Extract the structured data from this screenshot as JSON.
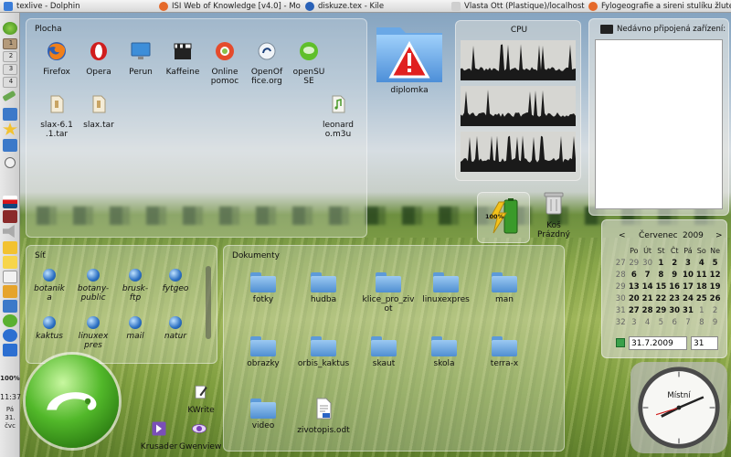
{
  "taskbar": {
    "tasks": [
      {
        "label": "texlive - Dolphin",
        "color": "#3b7dd8"
      },
      {
        "label": "ISI Web of Knowledge [v4.0] - Mo",
        "color": "#e5692a"
      },
      {
        "label": "diskuze.tex - Kile",
        "color": "#2a62b8"
      },
      {
        "label": "Vlasta Ott (Plastique)/localhost (P",
        "color": "#cfcfcf"
      },
      {
        "label": "Fylogeografie a sireni stulíku žlute",
        "color": "#e5692a"
      }
    ]
  },
  "left_panel": {
    "pager": [
      "1",
      "2",
      "3",
      "4"
    ],
    "battery_percent": "100%",
    "time": "11:37",
    "day_short": "Pá",
    "day_num": "31.",
    "month_short": "čvc"
  },
  "plocha": {
    "title": "Plocha",
    "apps": [
      {
        "label": "Firefox"
      },
      {
        "label": "Opera"
      },
      {
        "label": "Perun"
      },
      {
        "label": "Kaffeine"
      },
      {
        "label": "Online\npomoc"
      },
      {
        "label": "OpenOf\nfice.org"
      },
      {
        "label": "openSU\nSE"
      }
    ],
    "files": [
      {
        "label": "slax-6.1\n.1.tar"
      },
      {
        "label": "slax.tar"
      },
      {
        "label": "leonard\no.m3u"
      }
    ]
  },
  "desktop": {
    "diplomka_label": "diplomka",
    "trash_label": "Koš\nPrázdný",
    "battery_label": "100%",
    "kwrite_label": "KWrite",
    "krusader_label": "Krusader",
    "gwenview_label": "Gwenview"
  },
  "cpu": {
    "title": "CPU"
  },
  "devices": {
    "title": "Nedávno připojená zařízení:"
  },
  "sit": {
    "title": "Síť",
    "items": [
      {
        "label": "botanik\na"
      },
      {
        "label": "botany-\npublic"
      },
      {
        "label": "brusk-\nftp"
      },
      {
        "label": "fytgeo"
      },
      {
        "label": "kaktus"
      },
      {
        "label": "linuxex\npres"
      },
      {
        "label": "mail"
      },
      {
        "label": "natur"
      }
    ]
  },
  "dokumenty": {
    "title": "Dokumenty",
    "items": [
      {
        "label": "fotky"
      },
      {
        "label": "hudba"
      },
      {
        "label": "klice_pro_ziv\not"
      },
      {
        "label": "linuxexpres"
      },
      {
        "label": "man"
      },
      {
        "label": "obrazky"
      },
      {
        "label": "orbis_kaktus"
      },
      {
        "label": "skaut"
      },
      {
        "label": "skola"
      },
      {
        "label": "terra-x"
      },
      {
        "label": "video"
      },
      {
        "label": "zivotopis.odt"
      }
    ]
  },
  "calendar": {
    "month": "Červenec",
    "year": "2009",
    "weekday_headers": [
      "Po",
      "Út",
      "St",
      "Čt",
      "Pá",
      "So",
      "Ne"
    ],
    "weeks": [
      {
        "week": "27",
        "days": [
          "29",
          "30",
          "1",
          "2",
          "3",
          "4",
          "5"
        ],
        "dim_before": 2
      },
      {
        "week": "28",
        "days": [
          "6",
          "7",
          "8",
          "9",
          "10",
          "11",
          "12"
        ],
        "dim_before": 0
      },
      {
        "week": "29",
        "days": [
          "13",
          "14",
          "15",
          "16",
          "17",
          "18",
          "19"
        ],
        "dim_before": 0
      },
      {
        "week": "30",
        "days": [
          "20",
          "21",
          "22",
          "23",
          "24",
          "25",
          "26"
        ],
        "dim_before": 0
      },
      {
        "week": "31",
        "days": [
          "27",
          "28",
          "29",
          "30",
          "31",
          "1",
          "2"
        ],
        "dim_after": 5
      },
      {
        "week": "32",
        "days": [
          "3",
          "4",
          "5",
          "6",
          "7",
          "8",
          "9"
        ],
        "dim_before": 7
      }
    ],
    "date_value": "31.7.2009",
    "day_value": "31"
  },
  "clock": {
    "label": "Místní"
  }
}
